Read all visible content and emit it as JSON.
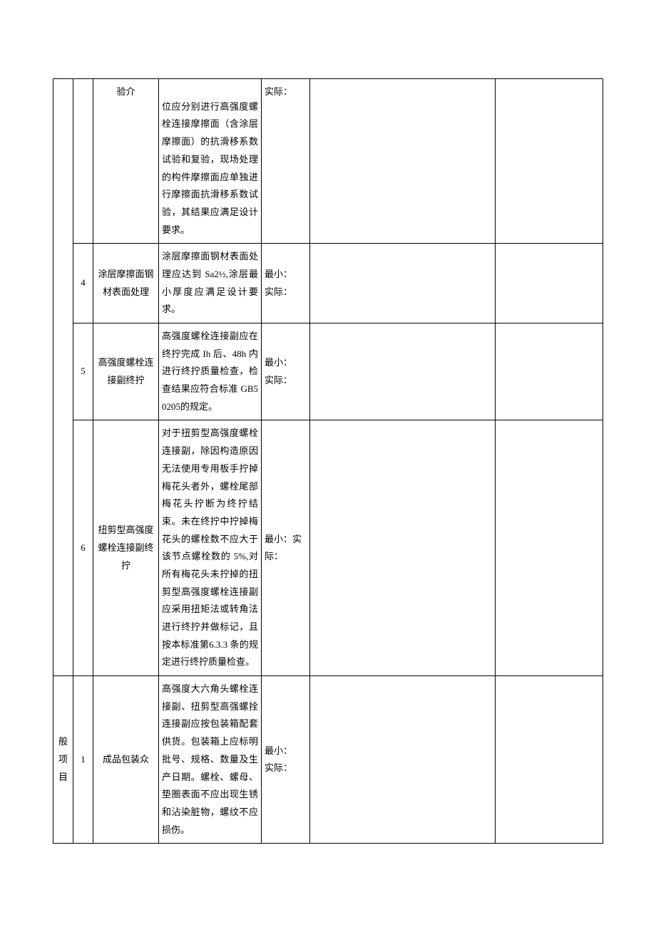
{
  "rows": [
    {
      "cat": "",
      "idx": "",
      "name": "验介",
      "spec": "位应分别进行高强度螺栓连接摩擦面（含涂层摩擦面）的抗滑移系数试验和复验，现场处理的构件摩擦面应单独进行摩擦面抗滑移系数试验，其结果应满足设计要求。",
      "meas": "实际：",
      "b1": "",
      "b2": ""
    },
    {
      "idx": "4",
      "name": "涂层摩擦面钢材表面处理",
      "spec": "涂层摩擦面钢材表面处理应达到 Sa2½,涂层最小厚度应满足设计要求。",
      "meas": "最小：\n实际：",
      "b1": "",
      "b2": ""
    },
    {
      "idx": "5",
      "name": "高强度螺栓连接副终拧",
      "spec": "高强度螺栓连接副应在终拧完成 Ih 后、48h 内进行终拧质量检查，检查结果应符合标准 GB50205的规定。",
      "meas": "最小：\n实际：",
      "b1": "",
      "b2": ""
    },
    {
      "idx": "6",
      "name": "扭剪型高强度螺栓连接副终拧",
      "spec": "对于扭剪型高强度螺栓连接副，除因构造原因无法使用专用板手拧掉梅花头者外，螺栓尾部梅花头拧断为终拧结束。未在终拧中拧掉梅花头的螺栓数不应大于该节点螺栓数的 5%,对所有梅花头未拧掉的扭剪型高强度螺栓连接副应采用扭矩法或转角法进行终拧并做标记，且按本标准第6.3.3 条的规定进行终拧质量检查。",
      "meas": "最小：实际：",
      "b1": "",
      "b2": ""
    },
    {
      "cat": "般项目",
      "idx": "1",
      "name": "成品包装众",
      "spec": "高强度大六角头螺栓连接副、扭剪型高强螺拴连接副应按包装箱配套供货。包装箱上应标明批号、规格、数量及生产日期。螺栓、螺母、垫圈表面不应出现生锈和沾染脏物，螺纹不应损伤。",
      "meas": "最小：\n实际：",
      "b1": "",
      "b2": ""
    }
  ]
}
